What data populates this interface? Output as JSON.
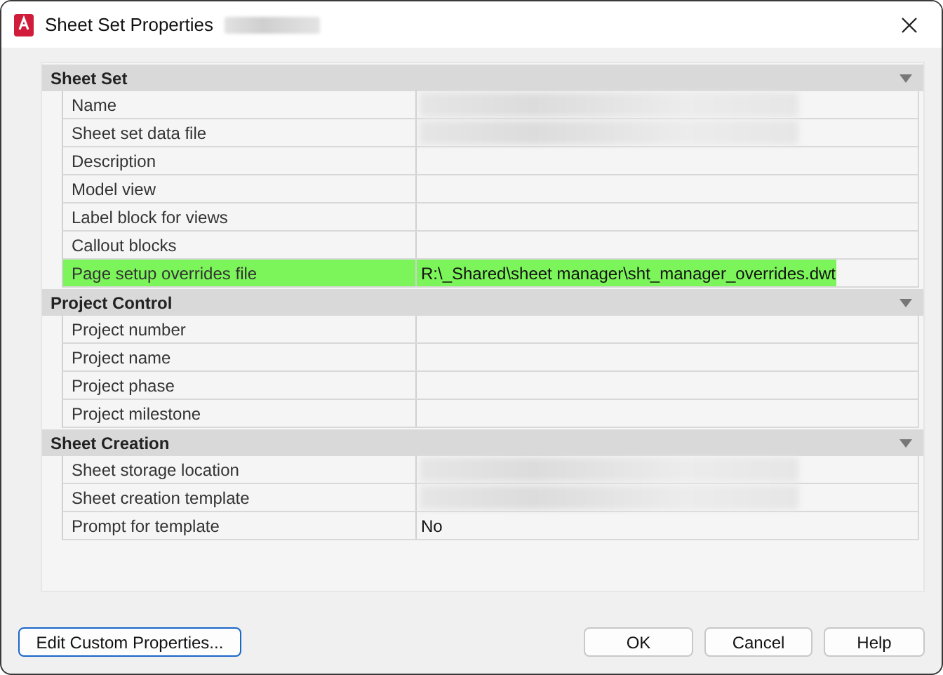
{
  "window": {
    "title": "Sheet Set Properties",
    "title_redacted": true
  },
  "categories": [
    {
      "name": "Sheet Set",
      "expanded": true,
      "properties": [
        {
          "name": "Name",
          "redacted": true,
          "highlighted": false
        },
        {
          "name": "Sheet set data file",
          "redacted": true,
          "highlighted": false
        },
        {
          "name": "Description",
          "redacted": false,
          "highlighted": false
        },
        {
          "name": "Model view",
          "redacted": false,
          "highlighted": false
        },
        {
          "name": "Label block for views",
          "redacted": false,
          "highlighted": false
        },
        {
          "name": "Callout blocks",
          "redacted": false,
          "highlighted": false
        },
        {
          "name": "Page setup overrides file",
          "value": "R:\\_Shared\\sheet manager\\sht_manager_overrides.dwt",
          "redacted": false,
          "highlighted": true
        }
      ]
    },
    {
      "name": "Project Control",
      "expanded": true,
      "properties": [
        {
          "name": "Project number",
          "redacted": false,
          "highlighted": false
        },
        {
          "name": "Project name",
          "redacted": false,
          "highlighted": false
        },
        {
          "name": "Project phase",
          "redacted": false,
          "highlighted": false
        },
        {
          "name": "Project milestone",
          "redacted": false,
          "highlighted": false
        }
      ]
    },
    {
      "name": "Sheet Creation",
      "expanded": true,
      "properties": [
        {
          "name": "Sheet storage location",
          "redacted": true,
          "highlighted": false
        },
        {
          "name": "Sheet creation template",
          "redacted": true,
          "highlighted": false
        },
        {
          "name": "Prompt for template",
          "value": "No",
          "redacted": false,
          "highlighted": false
        }
      ]
    }
  ],
  "buttons": [
    {
      "label": "Edit Custom Properties...",
      "default": true
    },
    {
      "label": "OK",
      "default": false
    },
    {
      "label": "Cancel",
      "default": false
    },
    {
      "label": "Help",
      "default": false
    }
  ]
}
